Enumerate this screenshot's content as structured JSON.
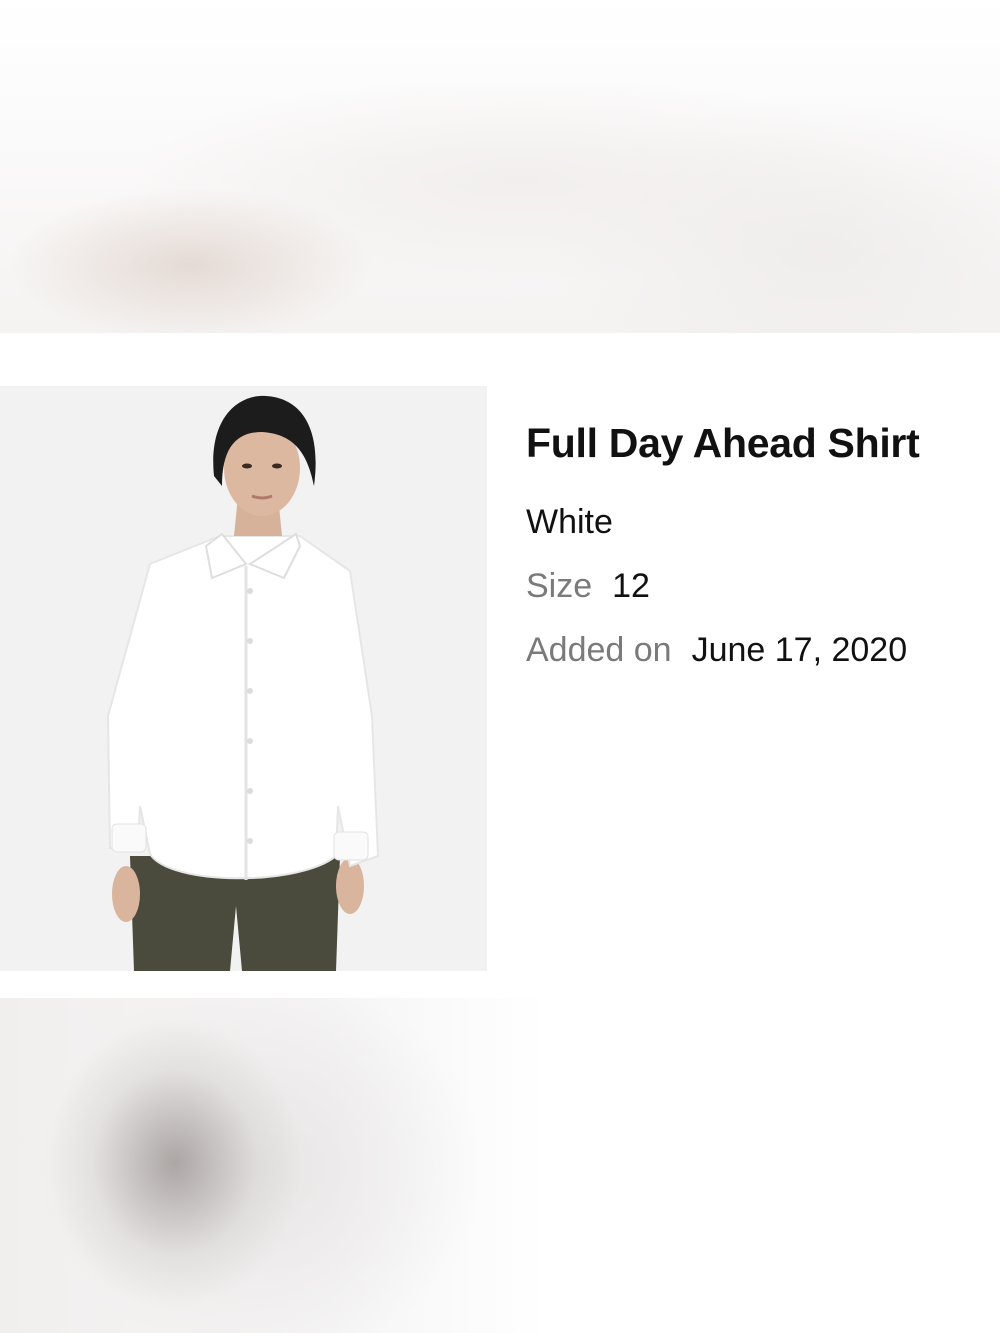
{
  "product": {
    "name": "Full Day Ahead Shirt",
    "color": "White",
    "size_label": "Size",
    "size_value": "12",
    "added_label": "Added on",
    "added_value": "June 17, 2020"
  }
}
